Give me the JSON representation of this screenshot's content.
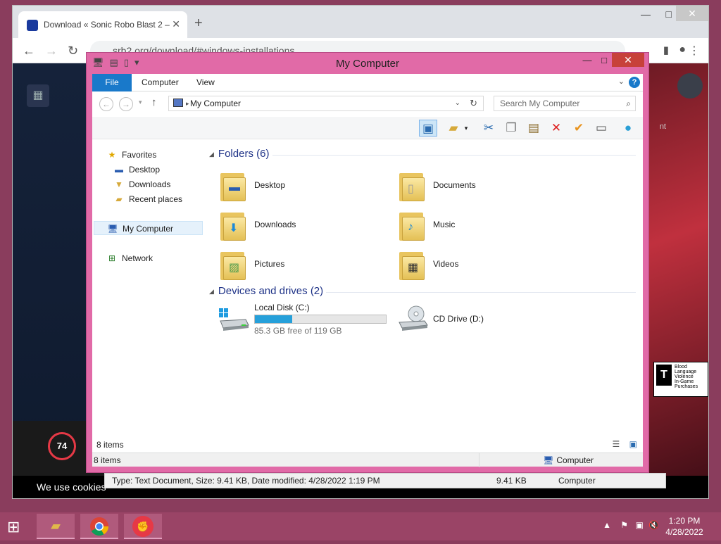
{
  "browser": {
    "tab_title": "Download « Sonic Robo Blast 2 –",
    "tab_close": "✕",
    "new_tab": "+",
    "url": "srb2.org/download/#windows-installations",
    "page": {
      "cookie_text": "We use cookies",
      "badge_value": "74",
      "side_text": "nt",
      "esrb": {
        "rating": "T",
        "lines": [
          "Blood",
          "Language",
          "Violence"
        ],
        "footer": "In-Game Purchases"
      }
    }
  },
  "explorer": {
    "title": "My Computer",
    "ribbon": {
      "tabs": [
        "File",
        "Computer",
        "View"
      ]
    },
    "address": {
      "path": "My Computer"
    },
    "search": {
      "placeholder": "Search My Computer"
    },
    "nav": {
      "favorites": "Favorites",
      "desktop": "Desktop",
      "downloads": "Downloads",
      "recent": "Recent places",
      "computer": "My Computer",
      "network": "Network"
    },
    "folders_header": "Folders (6)",
    "folders": [
      {
        "name": "Desktop",
        "icon": "desktop-folder-icon"
      },
      {
        "name": "Documents",
        "icon": "documents-folder-icon"
      },
      {
        "name": "Downloads",
        "icon": "downloads-folder-icon"
      },
      {
        "name": "Music",
        "icon": "music-folder-icon"
      },
      {
        "name": "Pictures",
        "icon": "pictures-folder-icon"
      },
      {
        "name": "Videos",
        "icon": "videos-folder-icon"
      }
    ],
    "devices_header": "Devices and drives (2)",
    "drives": [
      {
        "name": "Local Disk (C:)",
        "free": "85.3 GB free of 119 GB",
        "used_fraction": 0.283
      },
      {
        "name": "CD Drive (D:)"
      }
    ],
    "status": {
      "items": "8 items",
      "items2": "8 items",
      "location": "Computer"
    }
  },
  "under_status": {
    "details": "Type: Text Document, Size: 9.41 KB, Date modified: 4/28/2022 1:19 PM",
    "size": "9.41 KB",
    "location": "Computer"
  },
  "taskbar": {
    "time": "1:20 PM",
    "date": "4/28/2022"
  },
  "colors": {
    "window_frame": "#e16aa7",
    "taskbar": "#9a4466",
    "accent": "#1979ca"
  }
}
